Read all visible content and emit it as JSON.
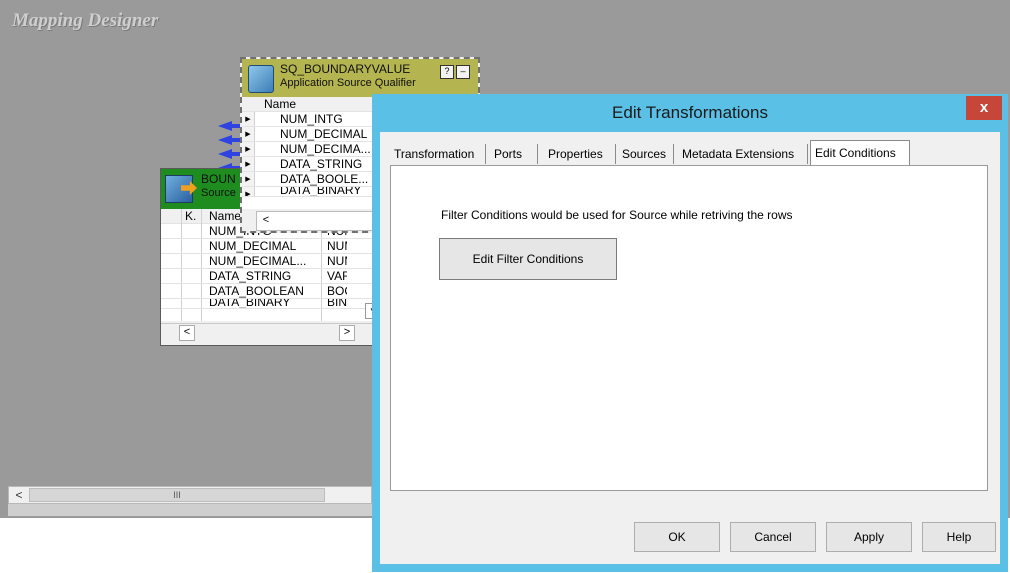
{
  "designer": {
    "title": "Mapping Designer",
    "hscroll_left": "<",
    "hscroll_thumb": "III"
  },
  "source_qualifier": {
    "name": "SQ_BOUNDARYVALUE",
    "type": "Application Source Qualifier",
    "help_btn": "?",
    "min_btn": "–",
    "column_header": "Name",
    "rows": [
      "NUM_INTG",
      "NUM_DECIMAL",
      "NUM_DECIMA...",
      "DATA_STRING",
      "DATA_BOOLE...",
      "DATA_BINARY"
    ],
    "scroll_left": "<"
  },
  "source_def": {
    "name": "BOUN",
    "type": "Source",
    "col_key": "K.",
    "col_name": "Name",
    "rows": [
      {
        "name": "NUM_INTG",
        "type": "NUMB"
      },
      {
        "name": "NUM_DECIMAL",
        "type": "NUMB"
      },
      {
        "name": "NUM_DECIMAL...",
        "type": "NUMI"
      },
      {
        "name": "DATA_STRING",
        "type": "VARC"
      },
      {
        "name": "DATA_BOOLEAN",
        "type": "BOOL"
      },
      {
        "name": "DATA_BINARY",
        "type": "BINAI"
      }
    ],
    "scroll_left": "<",
    "scroll_right": ">"
  },
  "dialog": {
    "title": "Edit Transformations",
    "close": "x",
    "tabs": [
      "Transformation",
      "Ports",
      "Properties",
      "Sources",
      "Metadata Extensions",
      "Edit Conditions"
    ],
    "active_tab": "Edit Conditions",
    "info_text": "Filter Conditions would be used for Source while retriving the rows",
    "filter_button": "Edit Filter Conditions",
    "buttons": {
      "ok": "OK",
      "cancel": "Cancel",
      "apply": "Apply",
      "help": "Help"
    }
  }
}
